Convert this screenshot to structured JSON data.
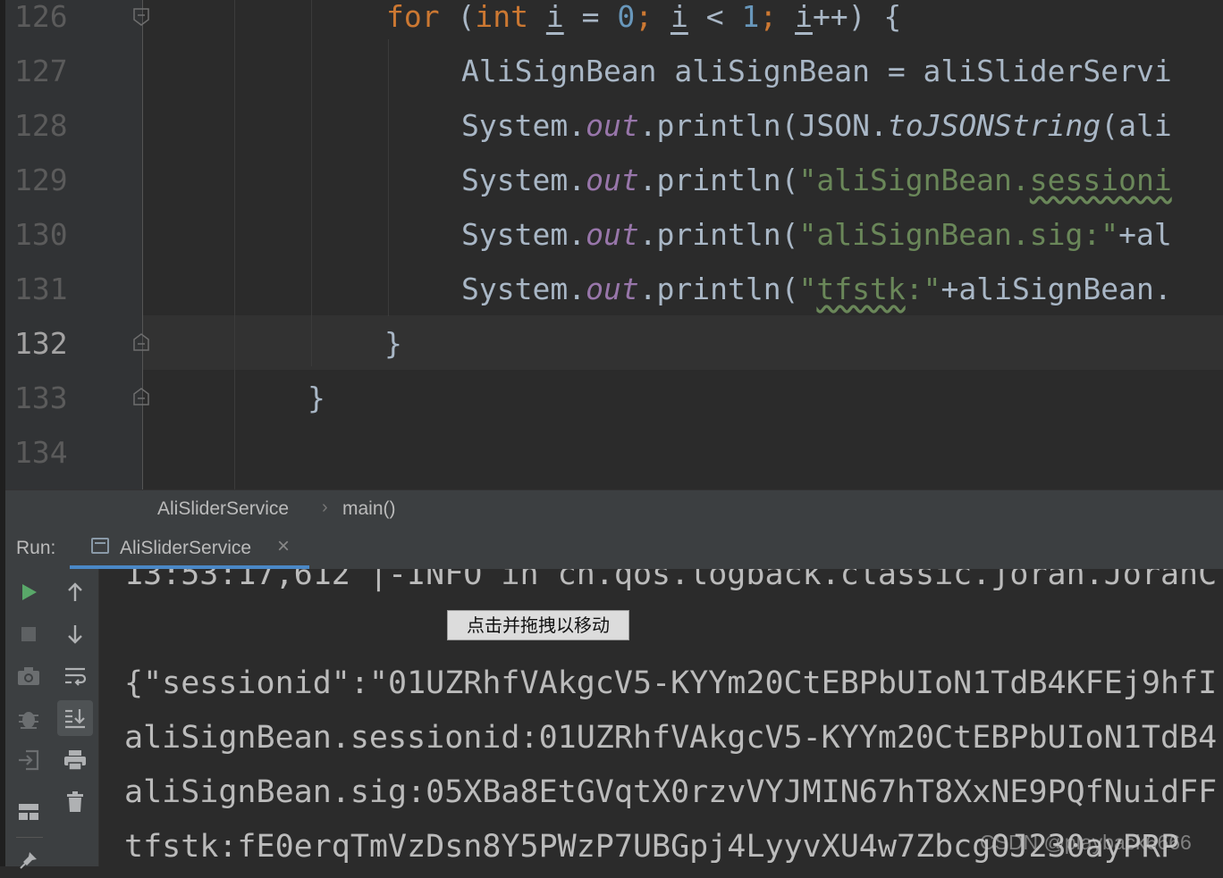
{
  "editor": {
    "lines": [
      {
        "num": "126"
      },
      {
        "num": "127"
      },
      {
        "num": "128"
      },
      {
        "num": "129"
      },
      {
        "num": "130"
      },
      {
        "num": "131"
      },
      {
        "num": "132"
      },
      {
        "num": "133"
      },
      {
        "num": "134"
      }
    ],
    "current_line": "132",
    "code": {
      "l126": {
        "kw_for": "for",
        "open": " (",
        "kw_int": "int",
        "sp": " ",
        "var1": "i",
        "eq": " = ",
        "zero": "0",
        "semi1": "; ",
        "var2": "i",
        "lt": " < ",
        "one": "1",
        "semi2": "; ",
        "var3": "i",
        "inc": "++) {"
      },
      "l127": {
        "text": "AliSignBean aliSignBean = aliSliderServi"
      },
      "l128": {
        "sys": "System.",
        "out": "out",
        "mid": ".println(JSON.",
        "call": "toJSONString",
        "tail": "(ali"
      },
      "l129": {
        "sys": "System.",
        "out": "out",
        "mid": ".println(",
        "str": "\"aliSignBean.",
        "wavy": "sessioni"
      },
      "l130": {
        "sys": "System.",
        "out": "out",
        "mid": ".println(",
        "str": "\"aliSignBean.sig:\"",
        "tail": "+al"
      },
      "l131": {
        "sys": "System.",
        "out": "out",
        "mid": ".println(",
        "q": "\"",
        "wavy": "tfstk",
        "str": ":\"",
        "tail": "+aliSignBean."
      },
      "l132": {
        "text": "}"
      },
      "l133": {
        "text": "}"
      }
    }
  },
  "breadcrumb": {
    "class_name": "AliSliderService",
    "separator": "›",
    "method": "main()"
  },
  "run": {
    "label": "Run:",
    "tab_label": "AliSliderService",
    "tab_close": "×",
    "toolbar_icons": [
      "run-icon",
      "stop-icon",
      "camera-icon",
      "debug-icon",
      "exit-icon",
      "layout-icon",
      "pin-icon",
      "up-arrow-icon",
      "down-arrow-icon",
      "soft-wrap-icon",
      "scroll-to-end-icon",
      "print-icon",
      "trash-icon"
    ]
  },
  "console": {
    "partial_line": "13:53:17,612 |-INFO in ch.qos.logback.classic.joran.JoranC",
    "lines": [
      "{\"sessionid\":\"01UZRhfVAkgcV5-KYYm20CtEBPbUIoN1TdB4KFEj9hfI",
      "aliSignBean.sessionid:01UZRhfVAkgcV5-KYYm20CtEBPbUIoN1TdB4",
      "aliSignBean.sig:05XBa8EtGVqtX0rzvVYJMIN67hT8XxNE9PQfNuidFF",
      "tfstk:fE0erqTmVzDsn8Y5PWzP7UBGpj4LyyvXU4w7ZbcgOJ230ayPRP"
    ]
  },
  "tooltip": {
    "text": "点击并拖拽以移动"
  },
  "watermark": {
    "text": "CSDN @playback6666"
  },
  "colors": {
    "keyword": "#cc7832",
    "number": "#6897bb",
    "string": "#6a8759",
    "field": "#9876aa",
    "default_text": "#a9b7c6",
    "run_green": "#59a869",
    "tab_underline": "#4a88c7"
  }
}
